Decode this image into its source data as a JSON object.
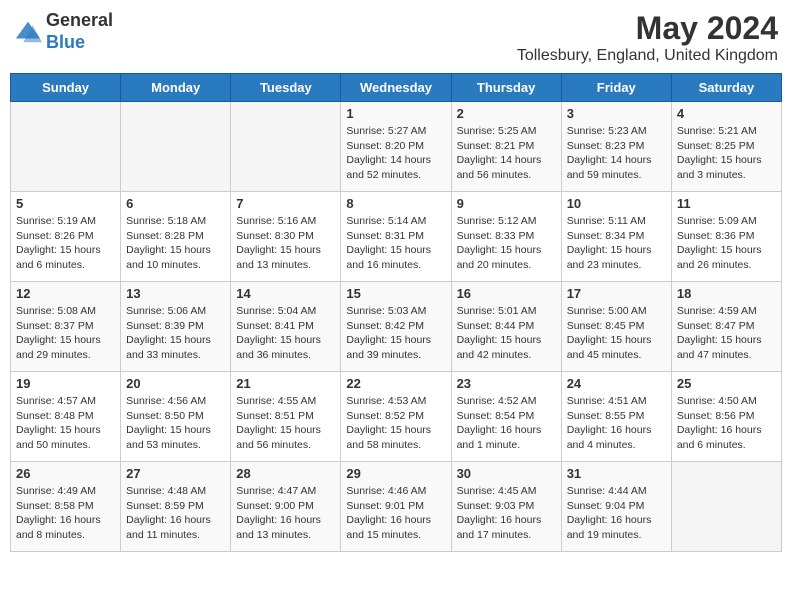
{
  "header": {
    "logo_line1": "General",
    "logo_line2": "Blue",
    "month_year": "May 2024",
    "location": "Tollesbury, England, United Kingdom"
  },
  "days_of_week": [
    "Sunday",
    "Monday",
    "Tuesday",
    "Wednesday",
    "Thursday",
    "Friday",
    "Saturday"
  ],
  "weeks": [
    [
      {
        "day": "",
        "info": ""
      },
      {
        "day": "",
        "info": ""
      },
      {
        "day": "",
        "info": ""
      },
      {
        "day": "1",
        "info": "Sunrise: 5:27 AM\nSunset: 8:20 PM\nDaylight: 14 hours and 52 minutes."
      },
      {
        "day": "2",
        "info": "Sunrise: 5:25 AM\nSunset: 8:21 PM\nDaylight: 14 hours and 56 minutes."
      },
      {
        "day": "3",
        "info": "Sunrise: 5:23 AM\nSunset: 8:23 PM\nDaylight: 14 hours and 59 minutes."
      },
      {
        "day": "4",
        "info": "Sunrise: 5:21 AM\nSunset: 8:25 PM\nDaylight: 15 hours and 3 minutes."
      }
    ],
    [
      {
        "day": "5",
        "info": "Sunrise: 5:19 AM\nSunset: 8:26 PM\nDaylight: 15 hours and 6 minutes."
      },
      {
        "day": "6",
        "info": "Sunrise: 5:18 AM\nSunset: 8:28 PM\nDaylight: 15 hours and 10 minutes."
      },
      {
        "day": "7",
        "info": "Sunrise: 5:16 AM\nSunset: 8:30 PM\nDaylight: 15 hours and 13 minutes."
      },
      {
        "day": "8",
        "info": "Sunrise: 5:14 AM\nSunset: 8:31 PM\nDaylight: 15 hours and 16 minutes."
      },
      {
        "day": "9",
        "info": "Sunrise: 5:12 AM\nSunset: 8:33 PM\nDaylight: 15 hours and 20 minutes."
      },
      {
        "day": "10",
        "info": "Sunrise: 5:11 AM\nSunset: 8:34 PM\nDaylight: 15 hours and 23 minutes."
      },
      {
        "day": "11",
        "info": "Sunrise: 5:09 AM\nSunset: 8:36 PM\nDaylight: 15 hours and 26 minutes."
      }
    ],
    [
      {
        "day": "12",
        "info": "Sunrise: 5:08 AM\nSunset: 8:37 PM\nDaylight: 15 hours and 29 minutes."
      },
      {
        "day": "13",
        "info": "Sunrise: 5:06 AM\nSunset: 8:39 PM\nDaylight: 15 hours and 33 minutes."
      },
      {
        "day": "14",
        "info": "Sunrise: 5:04 AM\nSunset: 8:41 PM\nDaylight: 15 hours and 36 minutes."
      },
      {
        "day": "15",
        "info": "Sunrise: 5:03 AM\nSunset: 8:42 PM\nDaylight: 15 hours and 39 minutes."
      },
      {
        "day": "16",
        "info": "Sunrise: 5:01 AM\nSunset: 8:44 PM\nDaylight: 15 hours and 42 minutes."
      },
      {
        "day": "17",
        "info": "Sunrise: 5:00 AM\nSunset: 8:45 PM\nDaylight: 15 hours and 45 minutes."
      },
      {
        "day": "18",
        "info": "Sunrise: 4:59 AM\nSunset: 8:47 PM\nDaylight: 15 hours and 47 minutes."
      }
    ],
    [
      {
        "day": "19",
        "info": "Sunrise: 4:57 AM\nSunset: 8:48 PM\nDaylight: 15 hours and 50 minutes."
      },
      {
        "day": "20",
        "info": "Sunrise: 4:56 AM\nSunset: 8:50 PM\nDaylight: 15 hours and 53 minutes."
      },
      {
        "day": "21",
        "info": "Sunrise: 4:55 AM\nSunset: 8:51 PM\nDaylight: 15 hours and 56 minutes."
      },
      {
        "day": "22",
        "info": "Sunrise: 4:53 AM\nSunset: 8:52 PM\nDaylight: 15 hours and 58 minutes."
      },
      {
        "day": "23",
        "info": "Sunrise: 4:52 AM\nSunset: 8:54 PM\nDaylight: 16 hours and 1 minute."
      },
      {
        "day": "24",
        "info": "Sunrise: 4:51 AM\nSunset: 8:55 PM\nDaylight: 16 hours and 4 minutes."
      },
      {
        "day": "25",
        "info": "Sunrise: 4:50 AM\nSunset: 8:56 PM\nDaylight: 16 hours and 6 minutes."
      }
    ],
    [
      {
        "day": "26",
        "info": "Sunrise: 4:49 AM\nSunset: 8:58 PM\nDaylight: 16 hours and 8 minutes."
      },
      {
        "day": "27",
        "info": "Sunrise: 4:48 AM\nSunset: 8:59 PM\nDaylight: 16 hours and 11 minutes."
      },
      {
        "day": "28",
        "info": "Sunrise: 4:47 AM\nSunset: 9:00 PM\nDaylight: 16 hours and 13 minutes."
      },
      {
        "day": "29",
        "info": "Sunrise: 4:46 AM\nSunset: 9:01 PM\nDaylight: 16 hours and 15 minutes."
      },
      {
        "day": "30",
        "info": "Sunrise: 4:45 AM\nSunset: 9:03 PM\nDaylight: 16 hours and 17 minutes."
      },
      {
        "day": "31",
        "info": "Sunrise: 4:44 AM\nSunset: 9:04 PM\nDaylight: 16 hours and 19 minutes."
      },
      {
        "day": "",
        "info": ""
      }
    ]
  ]
}
